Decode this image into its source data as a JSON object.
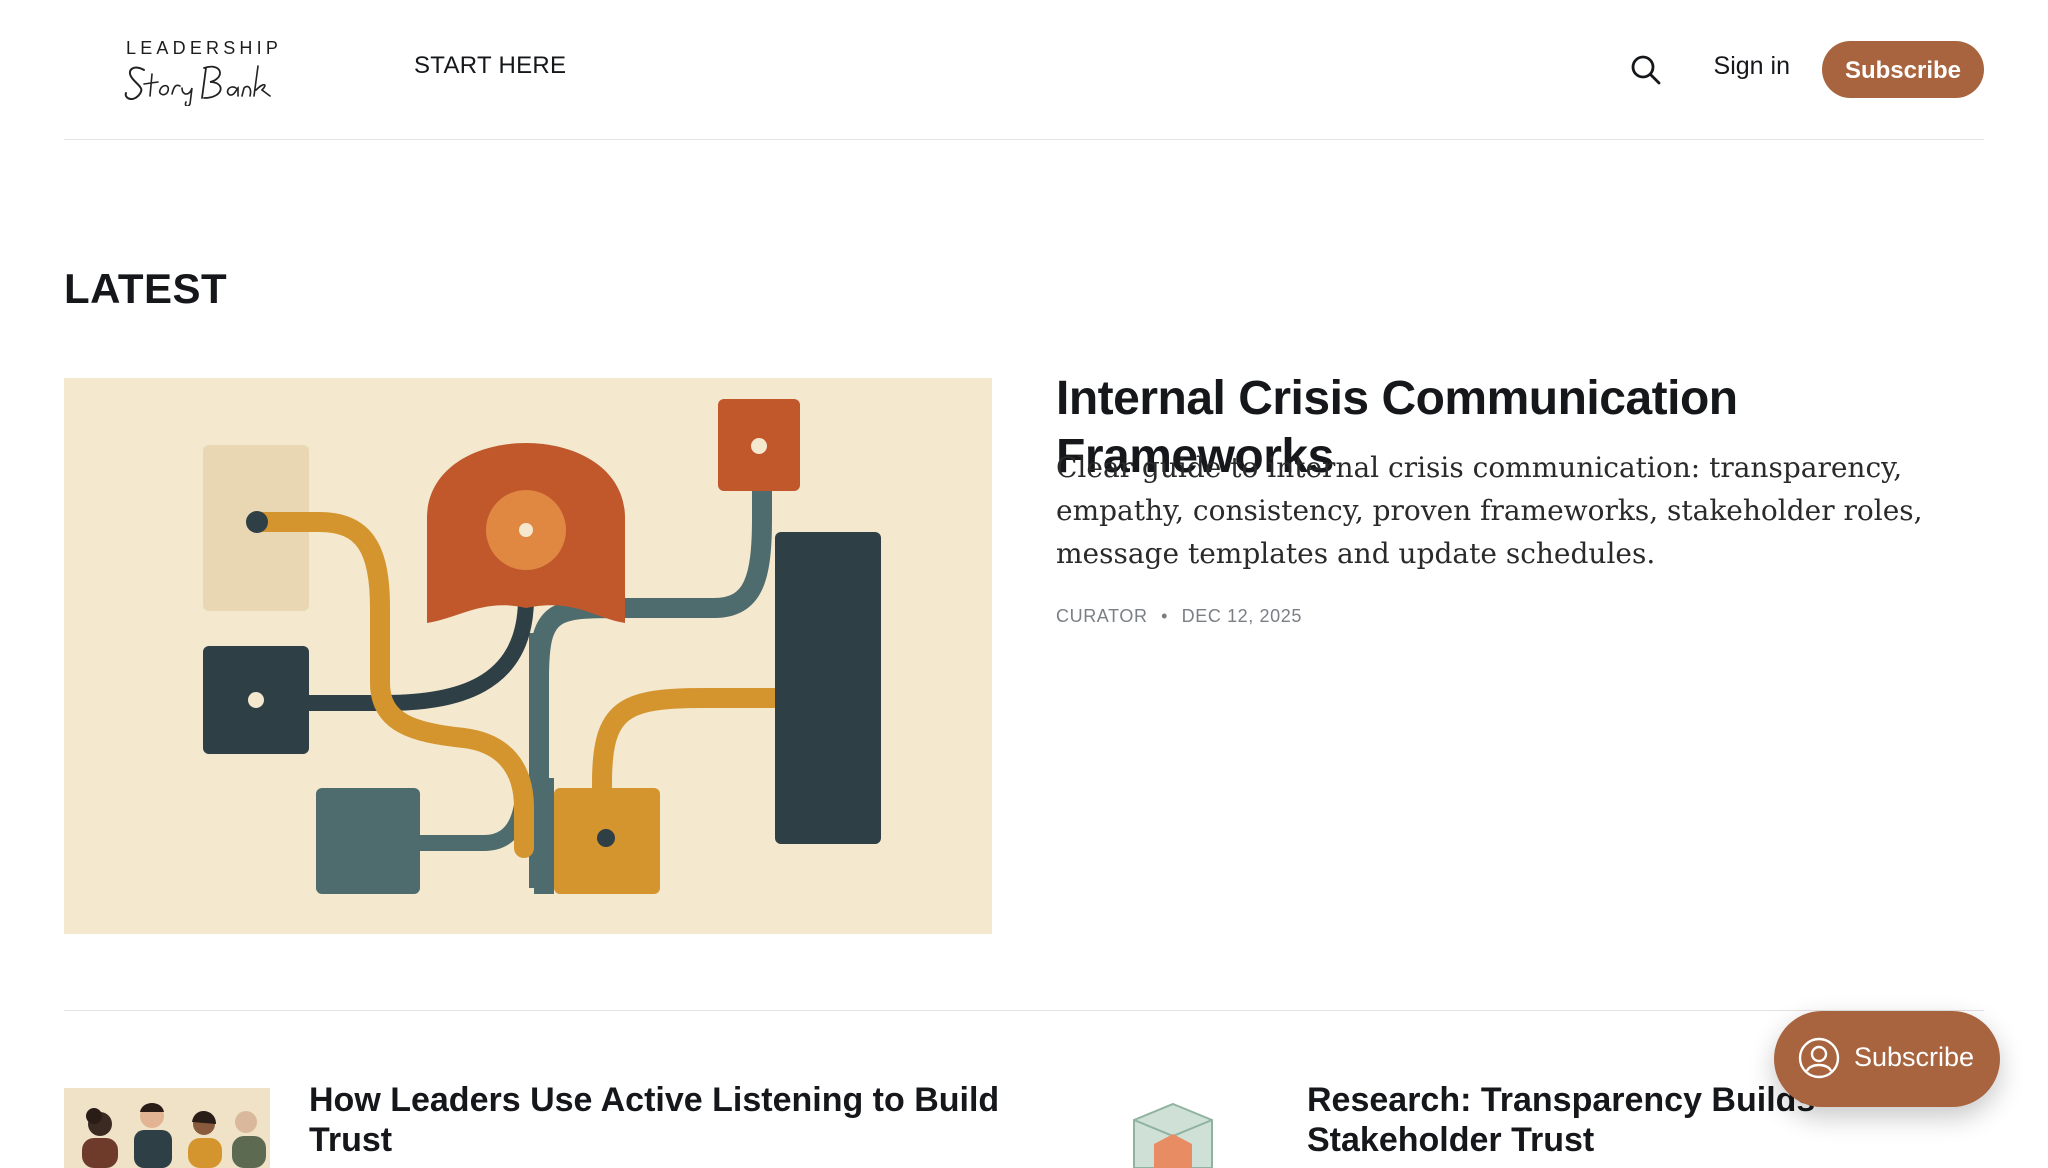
{
  "colors": {
    "accent": "#a8643e",
    "text": "#15171a",
    "muted": "#7a7f85",
    "divider": "#e3e3e3"
  },
  "header": {
    "logo_top": "LEADERSHIP",
    "logo_script": "Story Bank",
    "nav": [
      {
        "label": "START HERE"
      }
    ],
    "search_icon": "search-icon",
    "signin_label": "Sign in",
    "subscribe_label": "Subscribe"
  },
  "main": {
    "section_title": "LATEST",
    "featured": {
      "title": "Internal Crisis Communication Frameworks",
      "excerpt": "Clear guide to internal crisis communication: transparency, empathy, consistency, proven frameworks, stakeholder roles, message templates and update schedules.",
      "author": "CURATOR",
      "separator": "•",
      "date": "DEC 12, 2025"
    },
    "cards": [
      {
        "title": "How Leaders Use Active Listening to Build Trust"
      },
      {
        "title": "Research: Transparency Builds Stakeholder Trust"
      }
    ]
  },
  "floating": {
    "icon": "user-circle-icon",
    "label": "Subscribe"
  }
}
